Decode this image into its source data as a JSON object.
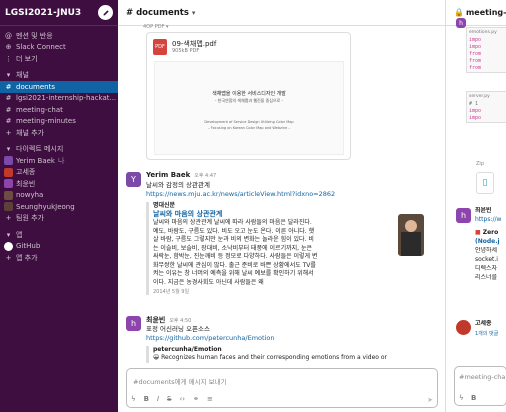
{
  "workspace": {
    "name": "LGSI2021-JNU3"
  },
  "sidebar": {
    "top_items": [
      {
        "icon": "mention-icon",
        "label": "멘션 및 반응"
      },
      {
        "icon": "connect-icon",
        "label": "Slack Connect"
      },
      {
        "icon": "more-icon",
        "label": "더 보기"
      }
    ],
    "channels_header": "채널",
    "channels": [
      {
        "label": "documents",
        "active": true
      },
      {
        "label": "lgsi2021-internship-hackat..."
      },
      {
        "label": "meeting-chat"
      },
      {
        "label": "meeting-minutes"
      }
    ],
    "add_channel": "채널 추가",
    "dm_header": "다이렉트 메시지",
    "dms": [
      {
        "label": "Yerim Baek",
        "suffix": "나",
        "color": "#7b4aa8"
      },
      {
        "label": "고세종",
        "color": "#c0392b"
      },
      {
        "label": "최윤빈",
        "color": "#8e44ad"
      },
      {
        "label": "nowyha",
        "color": "#6d4c41"
      },
      {
        "label": "SeunghyukJeong",
        "color": "#5d4037"
      }
    ],
    "add_teammate": "팀원 추가",
    "apps_header": "앱",
    "apps": [
      {
        "label": "GitHub"
      }
    ],
    "add_app": "앱 추가"
  },
  "channel": {
    "title": "# documents",
    "file_meta": "4OP PDF ▾",
    "pdf": {
      "name": "09-색채맵.pdf",
      "size": "905kB PDF",
      "title_ko": "색채맵을 이용한 서비스디자인 개발",
      "subtitle_ko": "- 한국연합의 색채맵과 웹진을 중심으로 -",
      "title_en": "Development of Service Design Utilizing Color Map",
      "subtitle_en": "– Focusing on Korean Color Map and Webzine –"
    },
    "messages": [
      {
        "avatar": "Y",
        "avatar_color": "#7b4aa8",
        "author": "Yerim Baek",
        "time": "오후 4:47",
        "text": "날씨와 감정의 상관관계",
        "link": "https://news.mju.ac.kr/news/articleView.html?idxno=2862",
        "unfurl": {
          "site": "명대신문",
          "title": "날씨와 마음의 상관관계",
          "body": "날씨와 마음의 상관관계 날씨에 따라 사람들의 마음은 달라진다. 예도, 바람도, 구름도 있다. 비도 오고 눈도 온다. 이른 아니다. 햇살 바람, 구름도 그렇지만 눈과 비의 변화는 놀라운 힘이 있다. 비는 이슬비, 보슬비, 장대비, 소낙비부터 태풍에 이르기까지, 눈은 싸락눈, 함박눈, 진눈깨비 등 정모로 다양하다. 사람들은 이렇게 변화무쌍한 날씨에 관심이 많다. 출근 준비로 바쁜 상황에서도 TV를 켜는 이유는 창 너머의 예측을 위해 날씨 예보를 확인하기 위해서이다. 지금은 농경사회도 아닌데 사람들은 왜",
          "date": "2014년 5월 9일"
        }
      },
      {
        "avatar": "h",
        "avatar_color": "#8e44ad",
        "author": "최윤빈",
        "time": "오후 4:50",
        "text": "표정 어신러닝 오픈소스",
        "link": "https://github.com/petercunha/Emotion",
        "repo": "petercunha/Emotion",
        "repo_desc": "😀 Recognizes human faces and their corresponding emotions from a video or"
      }
    ],
    "composer_placeholder": "#documents에게 메시지 보내기"
  },
  "thread": {
    "title": "meeting-cha",
    "code1_file": "emotions.py",
    "code1_lines": [
      "impo",
      "impo",
      "from",
      "from",
      "from"
    ],
    "code2_file": "server.py",
    "code2_lines": [
      "# 1",
      "impo",
      "impo"
    ],
    "zip_label": "Zip",
    "reply1_author": "최윤빈",
    "reply1_link": "https://w",
    "reply2_title": "Zero",
    "reply2_lines": [
      "(Node.j",
      "안녕하세",
      "socket.i",
      "디렉스자",
      "리스너를"
    ],
    "reply3_author": "고세종",
    "reply3_sub": "1개의 댓글",
    "composer_placeholder": "#meeting-cha"
  },
  "colors": {
    "sidebar_bg": "#3f0e40",
    "active_bg": "#1164a3",
    "link": "#1264a3"
  }
}
